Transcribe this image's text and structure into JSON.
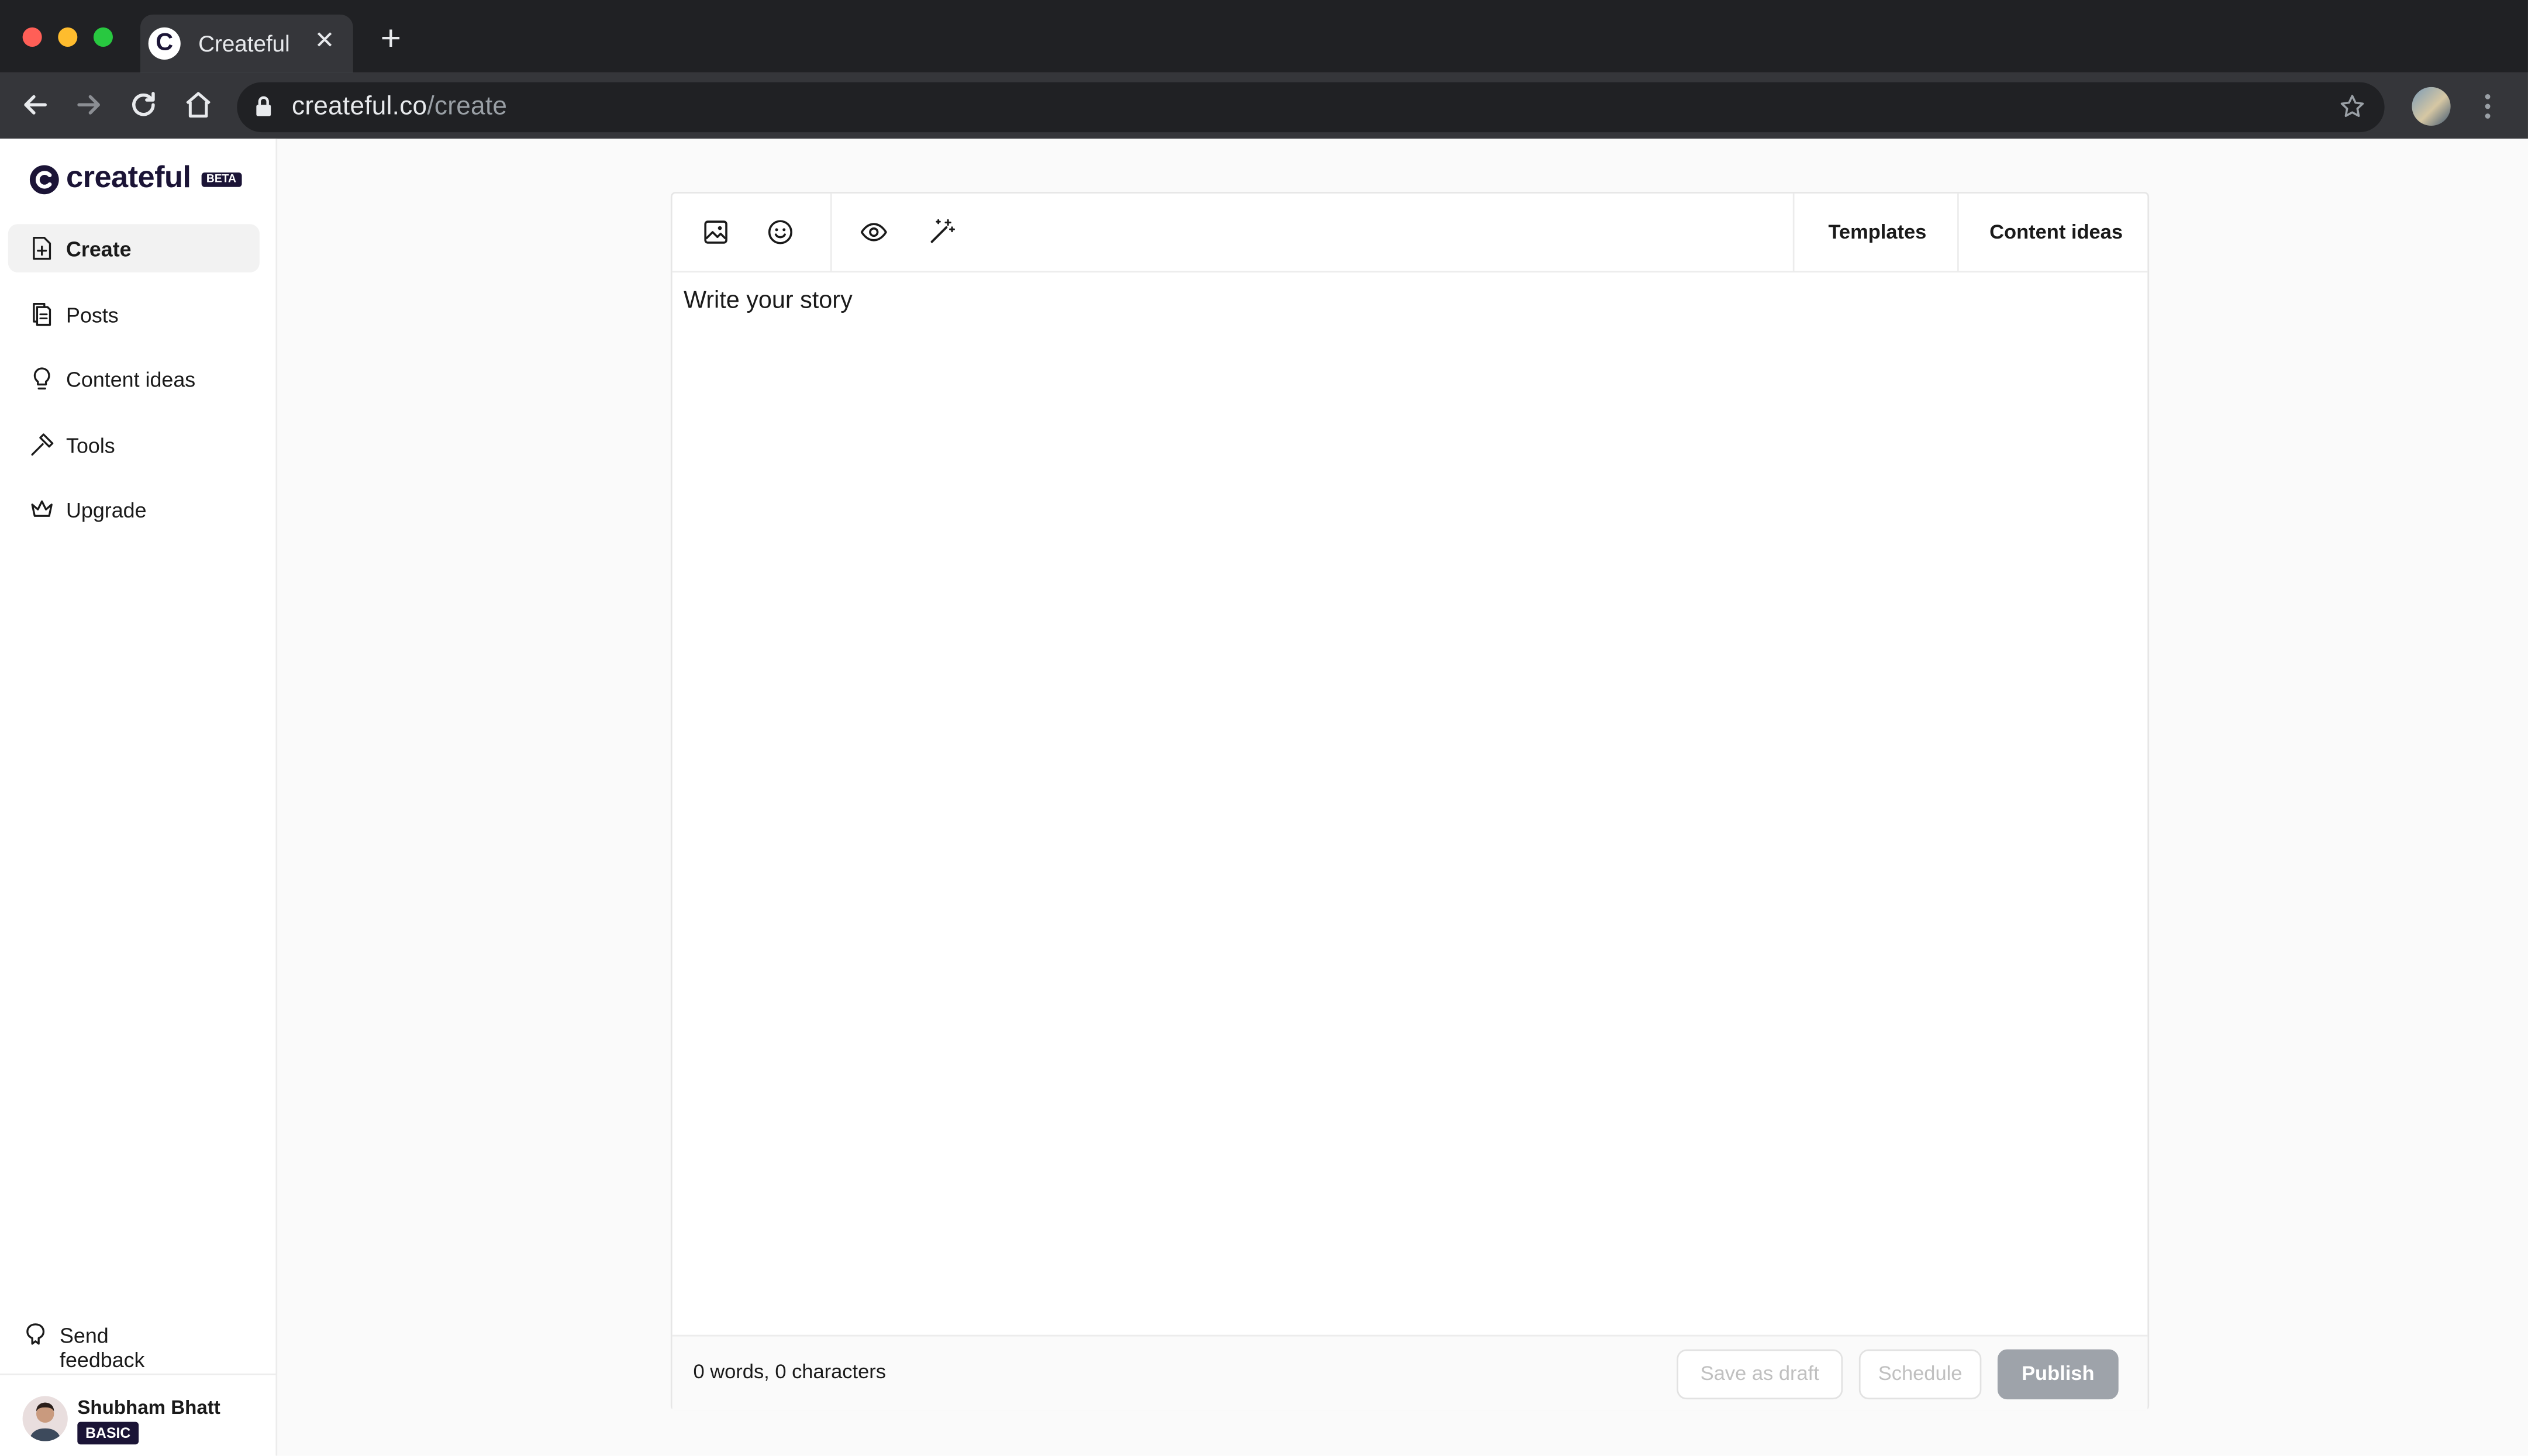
{
  "browser": {
    "tab_title": "Createful",
    "tab_favicon_letter": "C",
    "url_domain": "createful.co",
    "url_path": "/create",
    "colors": {
      "traffic_red": "#ff5f57",
      "traffic_yellow": "#febc2e",
      "traffic_green": "#28c840"
    }
  },
  "sidebar": {
    "brand": "createful",
    "beta_badge": "BETA",
    "items": [
      {
        "label": "Create",
        "icon": "file-plus-icon",
        "active": true
      },
      {
        "label": "Posts",
        "icon": "files-icon",
        "active": false
      },
      {
        "label": "Content ideas",
        "icon": "lightbulb-icon",
        "active": false
      },
      {
        "label": "Tools",
        "icon": "hammer-icon",
        "active": false
      },
      {
        "label": "Upgrade",
        "icon": "crown-icon",
        "active": false
      }
    ],
    "feedback_label": "Send feedback",
    "user": {
      "name": "Shubham Bhatt",
      "plan": "BASIC"
    }
  },
  "editor": {
    "tools": [
      "image-icon",
      "emoji-icon",
      "preview-eye-icon",
      "magic-wand-icon"
    ],
    "templates_label": "Templates",
    "content_ideas_label": "Content ideas",
    "placeholder": "Write your story",
    "counts": "0 words, 0 characters",
    "save_draft_label": "Save as draft",
    "schedule_label": "Schedule",
    "publish_label": "Publish"
  }
}
